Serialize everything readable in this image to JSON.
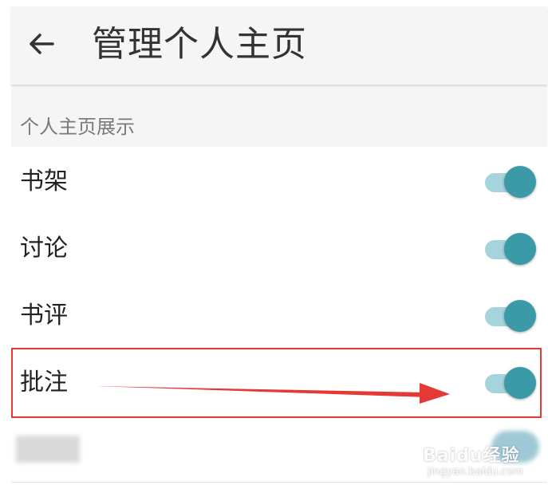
{
  "appbar": {
    "title": "管理个人主页",
    "back_icon": "arrow-left-icon"
  },
  "section": {
    "title": "个人主页展示"
  },
  "settings": [
    {
      "label": "书架",
      "enabled": true
    },
    {
      "label": "讨论",
      "enabled": true
    },
    {
      "label": "书评",
      "enabled": true
    },
    {
      "label": "批注",
      "enabled": true
    }
  ],
  "colors": {
    "accent": "#3a9aa8",
    "toggle_track": "#a6d4dc",
    "highlight": "#e53935",
    "appbar_bg": "#f5f5f5"
  },
  "watermark": {
    "logo": "Baidu经验",
    "url": "jingyan.baidu.com"
  }
}
